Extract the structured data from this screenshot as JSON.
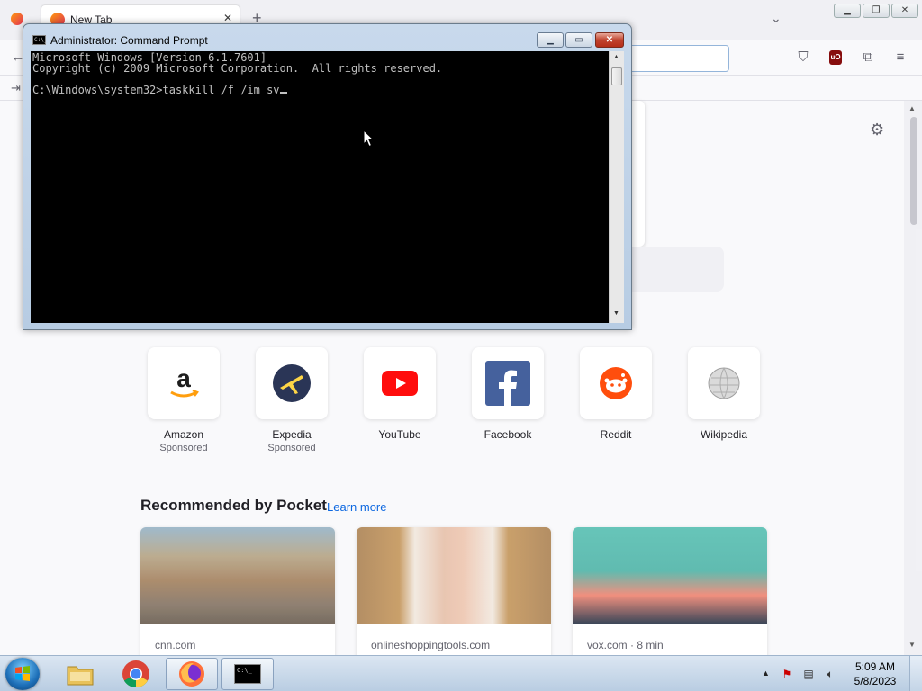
{
  "firefox": {
    "tab_title": "New Tab",
    "top_sites": [
      {
        "name": "Amazon",
        "sponsor": "Sponsored"
      },
      {
        "name": "Expedia",
        "sponsor": "Sponsored"
      },
      {
        "name": "YouTube",
        "sponsor": ""
      },
      {
        "name": "Facebook",
        "sponsor": ""
      },
      {
        "name": "Reddit",
        "sponsor": ""
      },
      {
        "name": "Wikipedia",
        "sponsor": ""
      }
    ],
    "pocket": {
      "title": "Recommended by Pocket",
      "learn_more": "Learn more",
      "cards": [
        {
          "source": "cnn.com"
        },
        {
          "source": "onlineshoppingtools.com"
        },
        {
          "source": "vox.com · 8 min"
        }
      ]
    }
  },
  "cmd": {
    "title": "Administrator: Command Prompt",
    "icon_text": "C:\\_",
    "lines": [
      "Microsoft Windows [Version 6.1.7601]",
      "Copyright (c) 2009 Microsoft Corporation.  All rights reserved.",
      "",
      "C:\\Windows\\system32>taskkill /f /im sv"
    ]
  },
  "taskbar": {
    "clock_time": "5:09 AM",
    "clock_date": "5/8/2023",
    "apps": [
      "explorer",
      "chrome",
      "firefox",
      "command-prompt"
    ]
  }
}
